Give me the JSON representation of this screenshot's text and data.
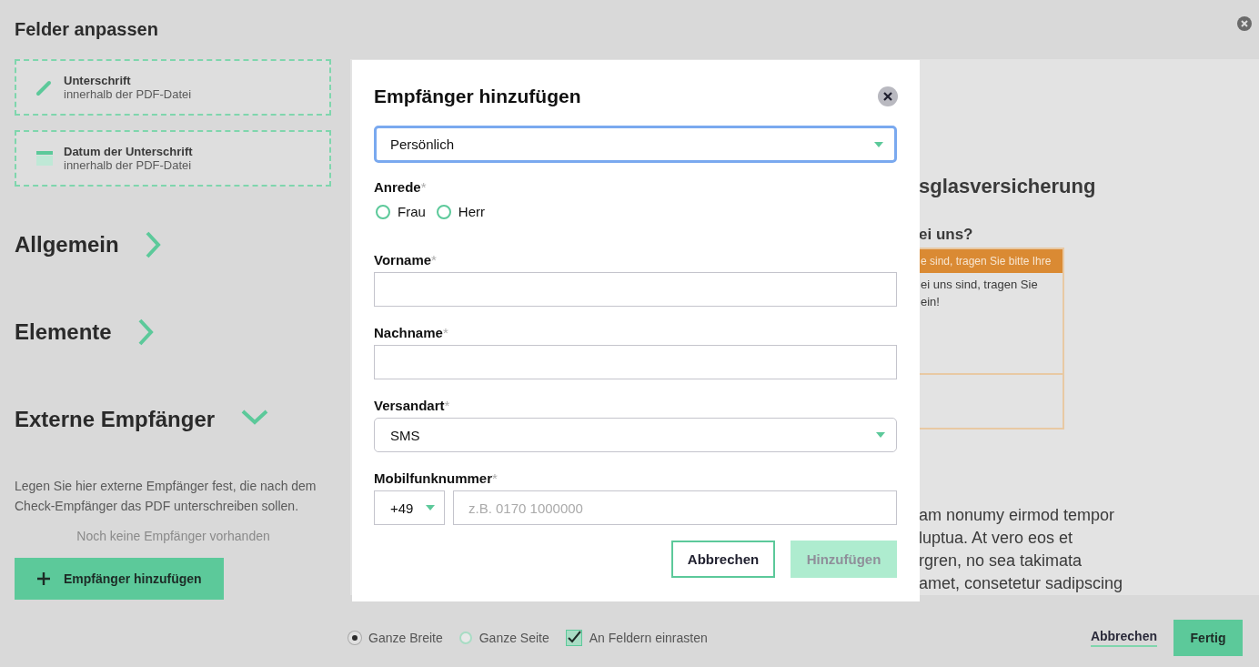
{
  "background": {
    "title": "Felder anpassen",
    "field_cards": [
      {
        "kind": "signature",
        "title": "Unterschrift",
        "subtitle": "innerhalb der PDF-Datei"
      },
      {
        "kind": "date",
        "title": "Datum der Unterschrift",
        "subtitle": "innerhalb der PDF-Datei"
      }
    ],
    "sections": [
      {
        "title": "Allgemein",
        "expanded": false
      },
      {
        "title": "Elemente",
        "expanded": false
      },
      {
        "title": "Externe Empfänger",
        "expanded": true
      }
    ],
    "recipients_hint": "Legen Sie hier externe Empfänger fest, die nach dem Check-Empfänger das PDF unterschreiben sollen.",
    "empty_text": "Noch keine Empfänger vorhanden",
    "add_button": "Empfänger hinzufügen",
    "document": {
      "heading": "sglasversicherung",
      "question": "ei uns?",
      "notice_bar": "e sind, tragen Sie bitte Ihre",
      "notice_lines": [
        "ei uns sind, tragen Sie",
        "ein!"
      ],
      "paragraph_lines": [
        "am nonumy eirmod tempor",
        "luptua. At vero eos et",
        "rgren, no sea takimata",
        "amet, consetetur sadipscing"
      ]
    },
    "toolbar": {
      "options": [
        {
          "kind": "radio",
          "label": "Ganze Breite",
          "selected": true
        },
        {
          "kind": "radio",
          "label": "Ganze Seite",
          "selected": false
        },
        {
          "kind": "checkbox",
          "label": "An Feldern einrasten",
          "checked": true
        }
      ],
      "cancel": "Abbrechen",
      "done": "Fertig"
    }
  },
  "dialog": {
    "title": "Empfänger hinzufügen",
    "type_select": {
      "value": "Persönlich",
      "focused": true
    },
    "salutation": {
      "label": "Anrede",
      "required_mark": "*",
      "options": [
        {
          "label": "Frau",
          "selected": false
        },
        {
          "label": "Herr",
          "selected": false
        }
      ]
    },
    "first_name": {
      "label": "Vorname",
      "required_mark": "*"
    },
    "last_name": {
      "label": "Nachname",
      "required_mark": "*"
    },
    "shipping": {
      "label": "Versandart",
      "required_mark": "*",
      "value": "SMS"
    },
    "mobile": {
      "label": "Mobilfunknummer",
      "required_mark": "*",
      "country_code": "+49",
      "placeholder": "z.B. 0170 1000000"
    },
    "cancel": "Abbrechen",
    "submit": {
      "label": "Hinzufügen",
      "disabled": true
    }
  }
}
